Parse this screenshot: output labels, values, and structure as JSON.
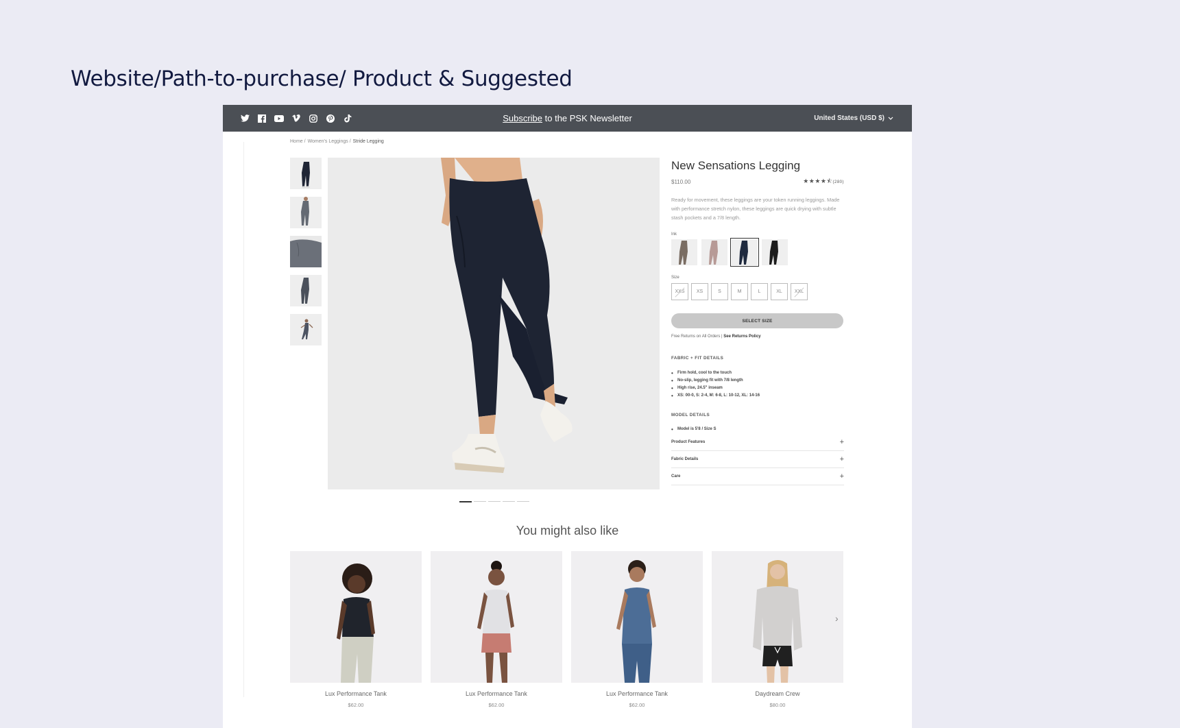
{
  "slide": {
    "title": "Website/Path-to-purchase/ Product & Suggested"
  },
  "topbar": {
    "social_icons": [
      "twitter-icon",
      "facebook-icon",
      "youtube-icon",
      "vimeo-icon",
      "instagram-icon",
      "pinterest-icon",
      "tiktok-icon"
    ],
    "subscribe_link": "Subscribe",
    "newsletter_text": " to the PSK Newsletter",
    "currency": "United States (USD $)",
    "background": "#4b4f55"
  },
  "breadcrumb": {
    "home": "Home /",
    "category": "Women's Leggings /",
    "current": "Stride Legging"
  },
  "gallery": {
    "thumbnail_count": 5,
    "dot_count": 5,
    "active_dot": 1
  },
  "product": {
    "title": "New Sensations Legging",
    "price": "$110.00",
    "rating_stars": "★★★★⯪",
    "rating_value": 4.5,
    "review_count": "(280)",
    "description": "Ready for movement, these leggings are your token running leggings. Made with performance stretch nylon, these leggings are quick drying with subtle stash pockets and a 7/8 length.",
    "color_label": "Ink",
    "colors": [
      "#7a6d63",
      "#b79a96",
      "#1f2a3f",
      "#1c1c1c"
    ],
    "selected_color_index": 2,
    "size_label": "Size",
    "sizes": [
      {
        "label": "XXS",
        "available": false
      },
      {
        "label": "XS",
        "available": true
      },
      {
        "label": "S",
        "available": true
      },
      {
        "label": "M",
        "available": true
      },
      {
        "label": "L",
        "available": true
      },
      {
        "label": "XL",
        "available": true
      },
      {
        "label": "XXL",
        "available": false
      }
    ],
    "select_size_button": "SELECT SIZE",
    "returns_text": "Free Returns on All Orders | ",
    "returns_link": "See Returns Policy",
    "fabric_fit_title": "FABRIC + FIT DETAILS",
    "fabric_fit_items": [
      "Firm hold, cool to the touch",
      "No-slip, legging fit with 7/8 length",
      "High rise, 24.5\" inseam",
      "XS: 00-0, S: 2-4, M: 6-8, L: 10-12, XL: 14-16"
    ],
    "model_title": "MODEL DETAILS",
    "model_items": [
      "Model is 5'8 / Size S"
    ],
    "accordions": [
      {
        "label": "Product Features",
        "icon": "+"
      },
      {
        "label": "Fabric Details",
        "icon": "+"
      },
      {
        "label": "Care",
        "icon": "+"
      }
    ]
  },
  "recommendations": {
    "title": "You might also like",
    "next_arrow": "›",
    "items": [
      {
        "name": "Lux Performance Tank",
        "price": "$62.00",
        "top": "#20242c",
        "bottom": "#cfcfc3",
        "skin": "#5a3a2a"
      },
      {
        "name": "Lux Performance Tank",
        "price": "$62.00",
        "top": "#e1e1e4",
        "bottom": "#c67c72",
        "skin": "#7a5340"
      },
      {
        "name": "Lux Performance Tank",
        "price": "$62.00",
        "top": "#4c6d96",
        "bottom": "#4c6d96",
        "skin": "#a97a5e"
      },
      {
        "name": "Daydream Crew",
        "price": "$80.00",
        "top": "#d2d0cf",
        "bottom": "#202020",
        "skin": "#e3c2a6"
      }
    ]
  }
}
